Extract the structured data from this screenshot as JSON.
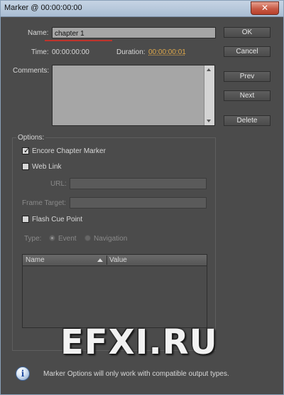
{
  "window": {
    "title": "Marker @ 00:00:00:00",
    "close_label": "✕"
  },
  "fields": {
    "name_label": "Name:",
    "name_value": "chapter 1",
    "time_label": "Time:",
    "time_value": "00:00:00:00",
    "duration_label": "Duration:",
    "duration_value": "00:00:00:01",
    "comments_label": "Comments:"
  },
  "buttons": {
    "ok": "OK",
    "cancel": "Cancel",
    "prev": "Prev",
    "next": "Next",
    "delete": "Delete"
  },
  "options": {
    "legend": "Options:",
    "encore_label": "Encore Chapter Marker",
    "encore_checked": true,
    "weblink_label": "Web Link",
    "url_label": "URL:",
    "frame_target_label": "Frame Target:",
    "flash_label": "Flash Cue Point",
    "type_label": "Type:",
    "type_event": "Event",
    "type_navigation": "Navigation",
    "table_headers": [
      "Name",
      "Value"
    ]
  },
  "footer": {
    "info_glyph": "i",
    "message": "Marker Options will only work with compatible output types."
  },
  "watermark": "EFXI.RU",
  "colors": {
    "duration_link": "#e0a94a",
    "name_underline": "#c0342c"
  }
}
